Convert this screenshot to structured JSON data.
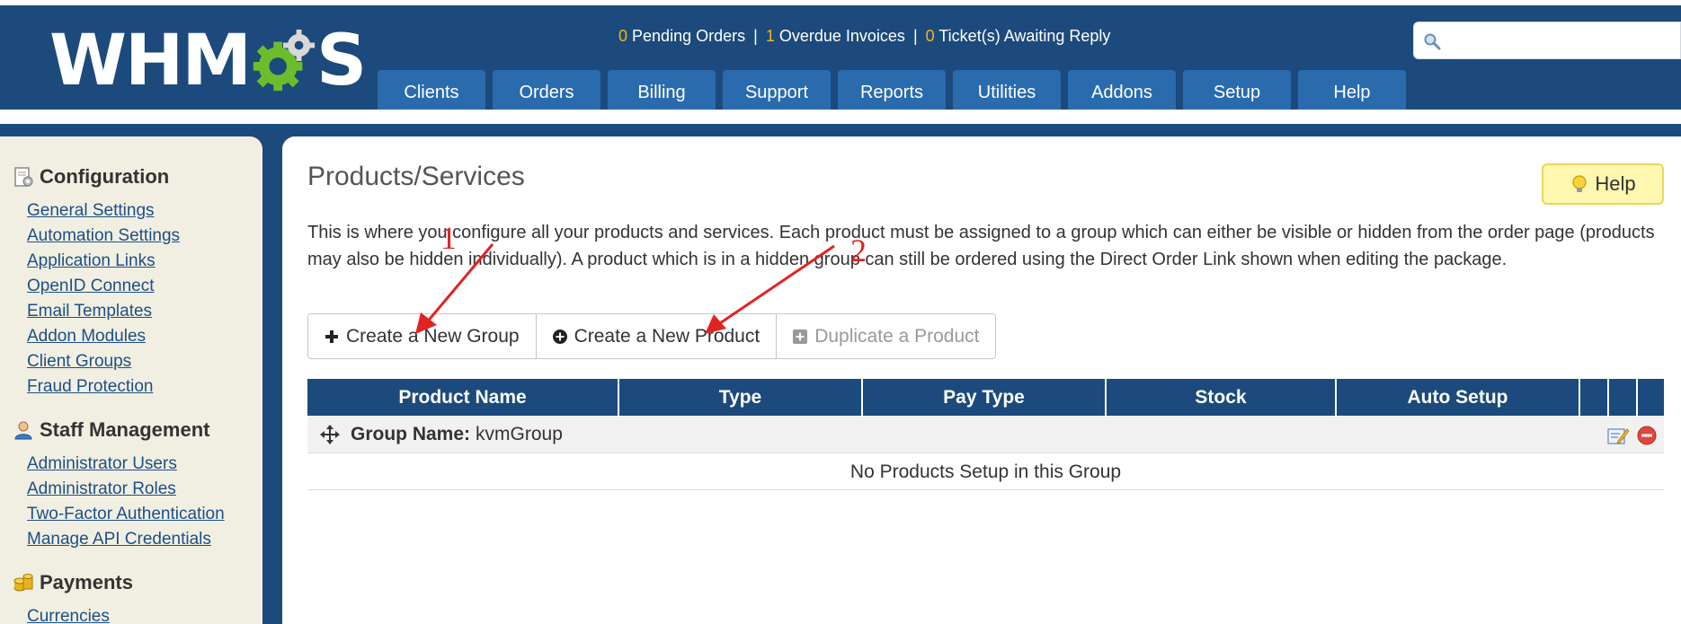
{
  "header": {
    "logo_text_left": "WHM",
    "logo_text_right": "S",
    "logo_brand": "WHMCS",
    "status": {
      "pending_orders_count": "0",
      "pending_orders_label": "Pending Orders",
      "overdue_invoices_count": "1",
      "overdue_invoices_label": "Overdue Invoices",
      "tickets_count": "0",
      "tickets_label": "Ticket(s) Awaiting Reply",
      "separator": "|"
    },
    "search": {
      "placeholder": "",
      "value": ""
    },
    "nav": [
      {
        "label": "Clients"
      },
      {
        "label": "Orders"
      },
      {
        "label": "Billing"
      },
      {
        "label": "Support"
      },
      {
        "label": "Reports"
      },
      {
        "label": "Utilities"
      },
      {
        "label": "Addons"
      },
      {
        "label": "Setup"
      },
      {
        "label": "Help"
      }
    ]
  },
  "sidebar": {
    "configuration": {
      "title": "Configuration",
      "links": [
        "General Settings",
        "Automation Settings",
        "Application Links",
        "OpenID Connect",
        "Email Templates",
        "Addon Modules",
        "Client Groups",
        "Fraud Protection"
      ]
    },
    "staff": {
      "title": "Staff Management",
      "links": [
        "Administrator Users",
        "Administrator Roles",
        "Two-Factor Authentication",
        "Manage API Credentials"
      ]
    },
    "payments": {
      "title": "Payments",
      "links": [
        "Currencies"
      ]
    }
  },
  "main": {
    "title": "Products/Services",
    "help_label": "Help",
    "intro": "This is where you configure all your products and services. Each product must be assigned to a group which can either be visible or hidden from the order page (products may also be hidden individually). A product which is in a hidden group can still be ordered using the Direct Order Link shown when editing the package.",
    "buttons": {
      "create_group": "Create a New Group",
      "create_product": "Create a New Product",
      "duplicate_product": "Duplicate a Product"
    },
    "table": {
      "columns": [
        "Product Name",
        "Type",
        "Pay Type",
        "Stock",
        "Auto Setup"
      ],
      "group_label": "Group Name:",
      "group_name": "kvmGroup",
      "empty_message": "No Products Setup in this Group"
    }
  },
  "annotations": {
    "marker_1": "1",
    "marker_2": "2",
    "arrow_color": "#e02424"
  },
  "colors": {
    "brand_blue": "#1c4a7c",
    "tab_blue": "#2a6bae",
    "status_accent": "#f4b41a",
    "logo_gear_green": "#6cbd2c",
    "sidebar_bg": "#f1efe2",
    "help_bg": "#fdf7b0"
  }
}
